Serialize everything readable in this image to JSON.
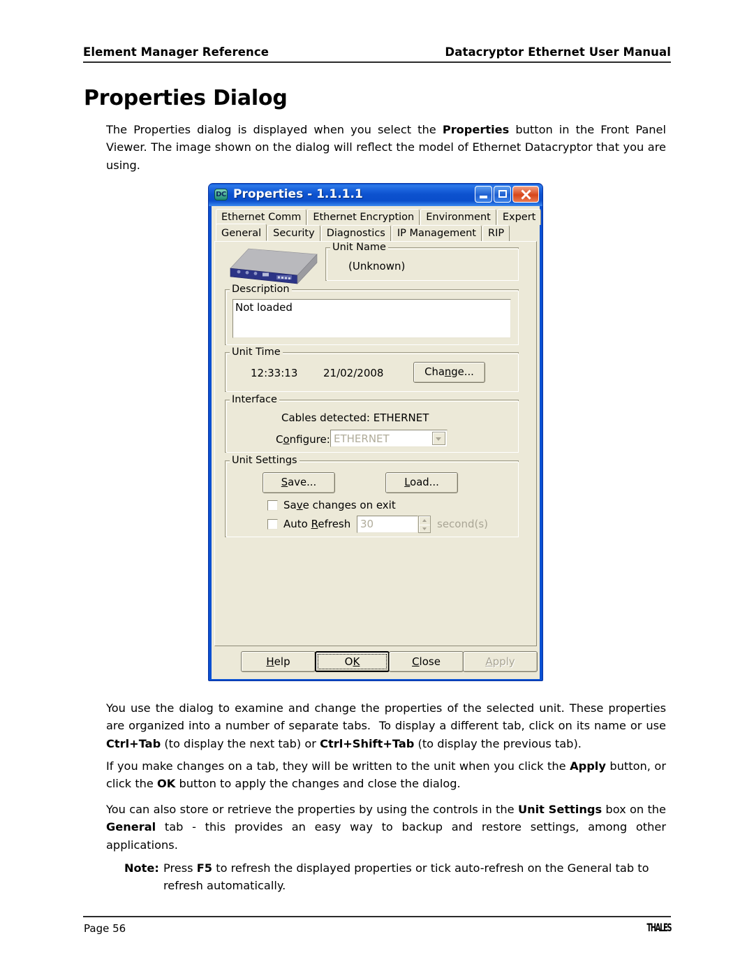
{
  "header": {
    "left": "Element Manager Reference",
    "right": "Datacryptor Ethernet User Manual"
  },
  "title": "Properties Dialog",
  "intro": "The Properties dialog is displayed when you select the Properties button in the Front Panel Viewer. The image shown on the dialog will reflect the model of Ethernet Datacryptor that you are using.",
  "dialog": {
    "window_icon": "datacryptor-dc-icon",
    "title": "Properties - 1.1.1.1",
    "titlebar_buttons": {
      "minimize": "minimize-icon",
      "maximize": "maximize-icon",
      "close": "close-icon"
    },
    "tabs_row1": [
      {
        "label": "Ethernet Comm",
        "selected": false
      },
      {
        "label": "Ethernet Encryption",
        "selected": false
      },
      {
        "label": "Environment",
        "selected": false
      },
      {
        "label": "Expert",
        "selected": false
      }
    ],
    "tabs_row2": [
      {
        "label": "General",
        "selected": true
      },
      {
        "label": "Security",
        "selected": false
      },
      {
        "label": "Diagnostics",
        "selected": false
      },
      {
        "label": "IP Management",
        "selected": false
      },
      {
        "label": "RIP",
        "selected": false
      }
    ],
    "unit_name": {
      "group_label": "Unit Name",
      "value": "(Unknown)"
    },
    "description": {
      "group_label": "Description",
      "value": "Not loaded"
    },
    "unit_time": {
      "group_label": "Unit Time",
      "time": "12:33:13",
      "date": "21/02/2008",
      "change_button": "Change..."
    },
    "interface": {
      "group_label": "Interface",
      "cables_detected": "Cables detected: ETHERNET",
      "configure_label": "Configure:",
      "configure_value": "ETHERNET",
      "configure_options": [
        "ETHERNET"
      ]
    },
    "unit_settings": {
      "group_label": "Unit Settings",
      "save_button": "Save...",
      "load_button": "Load...",
      "save_on_exit_label": "Save changes on exit",
      "save_on_exit_checked": false,
      "auto_refresh_label": "Auto Refresh",
      "auto_refresh_checked": false,
      "auto_refresh_value": "30",
      "auto_refresh_units": "second(s)"
    },
    "buttons": {
      "help": "Help",
      "ok": "OK",
      "close": "Close",
      "apply": "Apply",
      "apply_disabled": true
    },
    "colors": {
      "dialog_face": "#ECE9D8",
      "titlebar_blue": "#0A50D2",
      "close_red": "#D7461A",
      "disabled_text": "#A9A595"
    }
  },
  "paragraphs": {
    "p1": "You use the dialog to examine and change the properties of the selected unit. These properties are organized into a number of separate tabs.  To display a different tab, click on its name or use Ctrl+Tab (to display the next tab) or Ctrl+Shift+Tab (to display the previous tab).",
    "p2": "If you make changes on a tab, they will be written to the unit when you click the Apply button, or click the OK button to apply the changes and close the dialog.",
    "p3": "You can also store or retrieve the properties by using the controls in the Unit Settings box on the General tab - this provides an easy way to backup and restore settings, among other applications."
  },
  "note": {
    "label": "Note:",
    "text": "Press F5 to refresh the displayed properties or tick auto-refresh on the General tab to refresh automatically."
  },
  "footer": {
    "left": "Page 56",
    "right": "THALES"
  }
}
